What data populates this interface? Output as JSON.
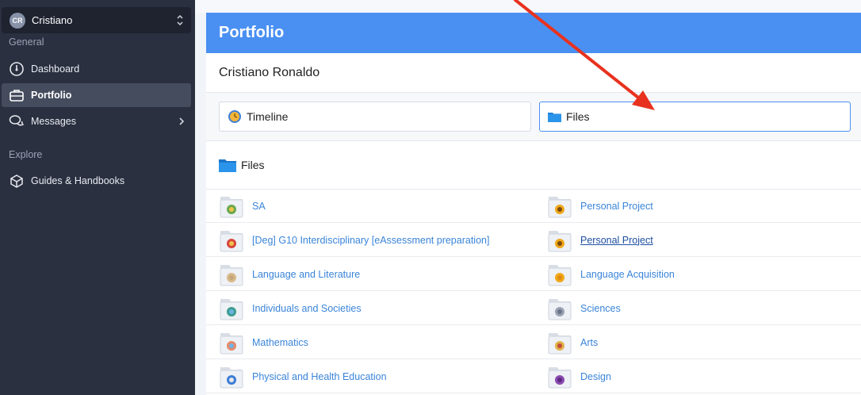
{
  "user": {
    "initials": "CR",
    "name": "Cristiano"
  },
  "sidebar": {
    "section_general": "General",
    "items": [
      {
        "label": "Dashboard",
        "icon": "dashboard-icon"
      },
      {
        "label": "Portfolio",
        "icon": "briefcase-icon",
        "active": true
      },
      {
        "label": "Messages",
        "icon": "chat-icon"
      }
    ],
    "section_explore": "Explore",
    "explore_items": [
      {
        "label": "Guides & Handbooks",
        "icon": "cube-icon"
      }
    ]
  },
  "main": {
    "title": "Portfolio",
    "student": "Cristiano Ronaldo",
    "tabs": [
      {
        "label": "Timeline",
        "icon": "timeline-icon"
      },
      {
        "label": "Files",
        "icon": "folder-icon",
        "selected": true
      }
    ],
    "files_heading": "Files",
    "folders": [
      {
        "left": "SA",
        "right": "Personal Project"
      },
      {
        "left": "[Deg] G10 Interdisciplinary [eAssessment preparation]",
        "right": "Personal Project"
      },
      {
        "left": "Language and Literature",
        "right": "Language Acquisition"
      },
      {
        "left": "Individuals and Societies",
        "right": "Sciences"
      },
      {
        "left": "Mathematics",
        "right": "Arts"
      },
      {
        "left": "Physical and Health Education",
        "right": "Design"
      }
    ]
  },
  "colors": {
    "accent": "#4a90f2",
    "sidebar": "#2b3040",
    "link": "#3a84d9",
    "annotation_arrow": "#e8321f"
  }
}
